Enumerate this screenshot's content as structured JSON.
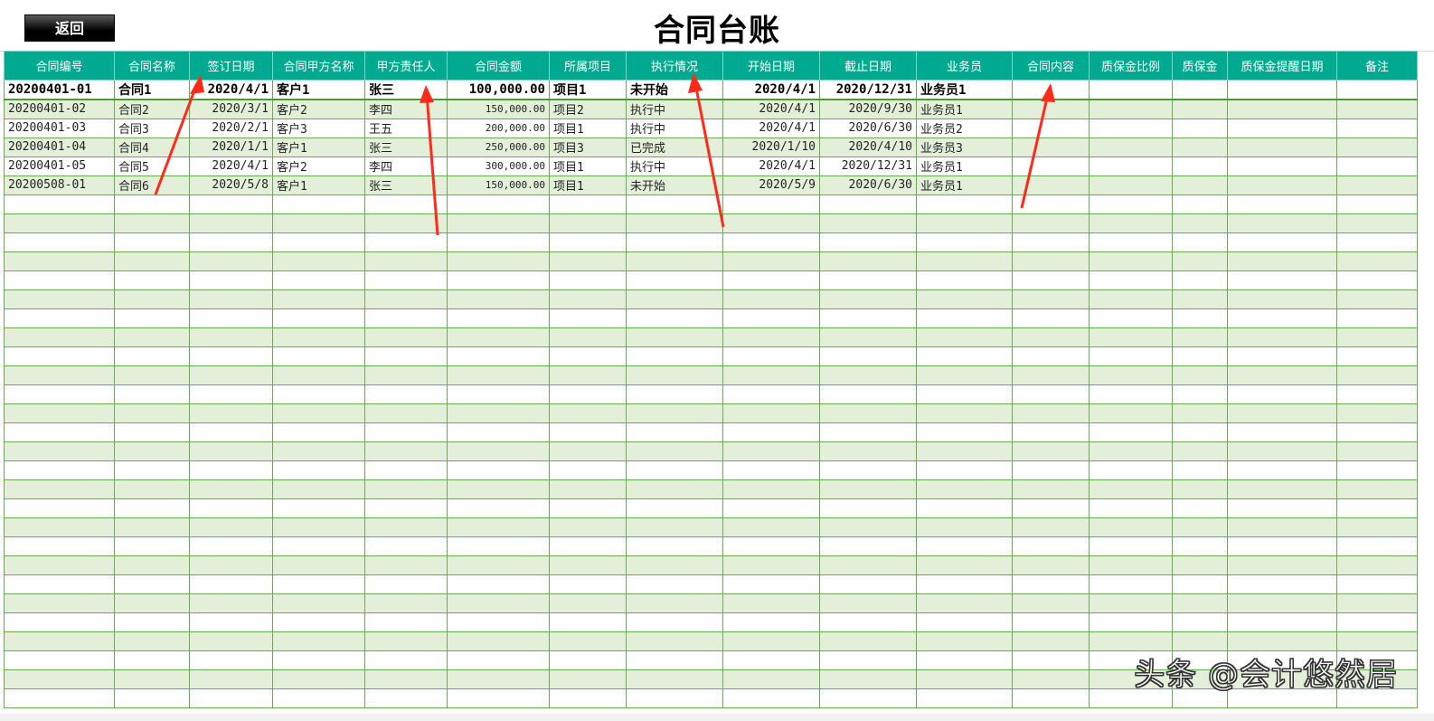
{
  "toolbar": {
    "back_label": "返回"
  },
  "title": "合同台账",
  "columns": [
    "合同编号",
    "合同名称",
    "签订日期",
    "合同甲方名称",
    "甲方责任人",
    "合同金额",
    "所属项目",
    "执行情况",
    "开始日期",
    "截止日期",
    "业务员",
    "合同内容",
    "质保金比例",
    "质保金",
    "质保金提醒日期",
    "备注"
  ],
  "rows": [
    [
      "20200401-01",
      "合同1",
      "2020/4/1",
      "客户1",
      "张三",
      "100,000.00",
      "项目1",
      "未开始",
      "2020/4/1",
      "2020/12/31",
      "业务员1",
      "",
      "",
      "",
      "",
      ""
    ],
    [
      "20200401-02",
      "合同2",
      "2020/3/1",
      "客户2",
      "李四",
      "150,000.00",
      "项目2",
      "执行中",
      "2020/4/1",
      "2020/9/30",
      "业务员1",
      "",
      "",
      "",
      "",
      ""
    ],
    [
      "20200401-03",
      "合同3",
      "2020/2/1",
      "客户3",
      "王五",
      "200,000.00",
      "项目1",
      "执行中",
      "2020/4/1",
      "2020/6/30",
      "业务员2",
      "",
      "",
      "",
      "",
      ""
    ],
    [
      "20200401-04",
      "合同4",
      "2020/1/1",
      "客户1",
      "张三",
      "250,000.00",
      "项目3",
      "已完成",
      "2020/1/10",
      "2020/4/10",
      "业务员3",
      "",
      "",
      "",
      "",
      ""
    ],
    [
      "20200401-05",
      "合同5",
      "2020/4/1",
      "客户2",
      "李四",
      "300,000.00",
      "项目1",
      "执行中",
      "2020/4/1",
      "2020/12/31",
      "业务员1",
      "",
      "",
      "",
      "",
      ""
    ],
    [
      "20200508-01",
      "合同6",
      "2020/5/8",
      "客户1",
      "张三",
      "150,000.00",
      "项目1",
      "未开始",
      "2020/5/9",
      "2020/6/30",
      "业务员1",
      "",
      "",
      "",
      "",
      ""
    ]
  ],
  "empty_row_count": 27,
  "watermark": "头条 @会计悠然居",
  "colors": {
    "header_bg": "#00aa90",
    "row_alt": "#e3efd9",
    "grid": "#6aaa52",
    "arrow": "#ff2a1a"
  }
}
